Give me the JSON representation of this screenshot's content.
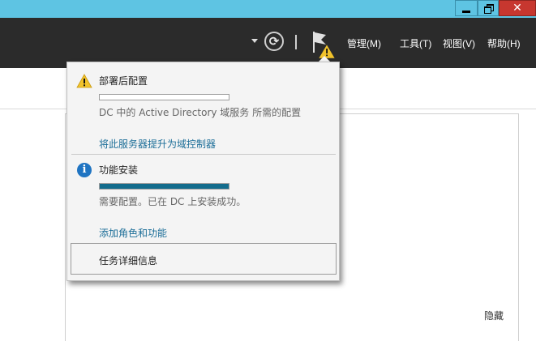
{
  "window": {
    "minimize_icon": "minimize-icon",
    "restore_icon": "restore-icon",
    "close_glyph": "✕",
    "accent_color": "#5ec4e3",
    "close_color": "#c7372f"
  },
  "header": {
    "refresh_glyph": "⟳",
    "menu": [
      "管理(M)",
      "工具(T)",
      "视图(V)",
      "帮助(H)"
    ],
    "notification_flag_icon": "flag-warning-icon"
  },
  "notifications": [
    {
      "icon": "warning-icon",
      "title": "部署后配置",
      "progress": 0,
      "description": "DC 中的 Active Directory 域服务 所需的配置",
      "link": "将此服务器提升为域控制器"
    },
    {
      "icon": "info-icon",
      "title": "功能安装",
      "progress": 1,
      "description": "需要配置。已在 DC 上安装成功。",
      "link": "添加角色和功能"
    }
  ],
  "task_details_label": "任务详细信息",
  "info_glyph": "i",
  "hide_label": "隐藏"
}
